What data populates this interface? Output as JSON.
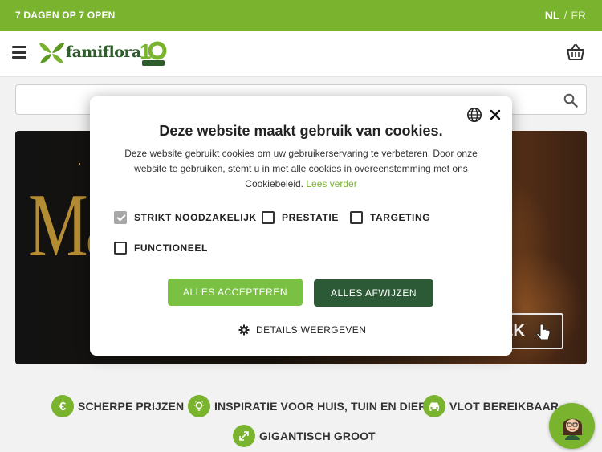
{
  "topbar": {
    "hours": "7 DAGEN OP 7 OPEN",
    "lang_active": "NL",
    "lang_separator": "/",
    "lang_other": "FR"
  },
  "header": {
    "logo_text": "famiflora",
    "logo_badge": "10",
    "logo_badge_sub": "JAAR"
  },
  "hero": {
    "headline_partial": "Ma",
    "cta_partial": "EK"
  },
  "usps": [
    {
      "icon": "euro-icon",
      "label": "SCHERPE PRIJZEN"
    },
    {
      "icon": "lightbulb-icon",
      "label": "INSPIRATIE VOOR HUIS, TUIN EN DIER"
    },
    {
      "icon": "car-icon",
      "label": "VLOT BEREIKBAAR"
    },
    {
      "icon": "expand-icon",
      "label": "GIGANTISCH GROOT"
    }
  ],
  "cookie": {
    "title": "Deze website maakt gebruik van cookies.",
    "description": "Deze website gebruikt cookies om uw gebruikerservaring te verbeteren. Door onze website te gebruiken, stemt u in met alle cookies in overeenstemming met ons Cookiebeleid.",
    "read_more": "Lees verder",
    "categories": [
      {
        "label": "STRIKT NOODZAKELIJK",
        "checked": true,
        "disabled": true
      },
      {
        "label": "PRESTATIE",
        "checked": false
      },
      {
        "label": "TARGETING",
        "checked": false
      },
      {
        "label": "FUNCTIONEEL",
        "checked": false
      }
    ],
    "accept_all": "ALLES ACCEPTEREN",
    "reject_all": "ALLES AFWIJZEN",
    "show_details": "DETAILS WEERGEVEN"
  },
  "colors": {
    "brand_green": "#7ab32e",
    "dark_green": "#2d5a36",
    "accept_green": "#7ac143"
  }
}
